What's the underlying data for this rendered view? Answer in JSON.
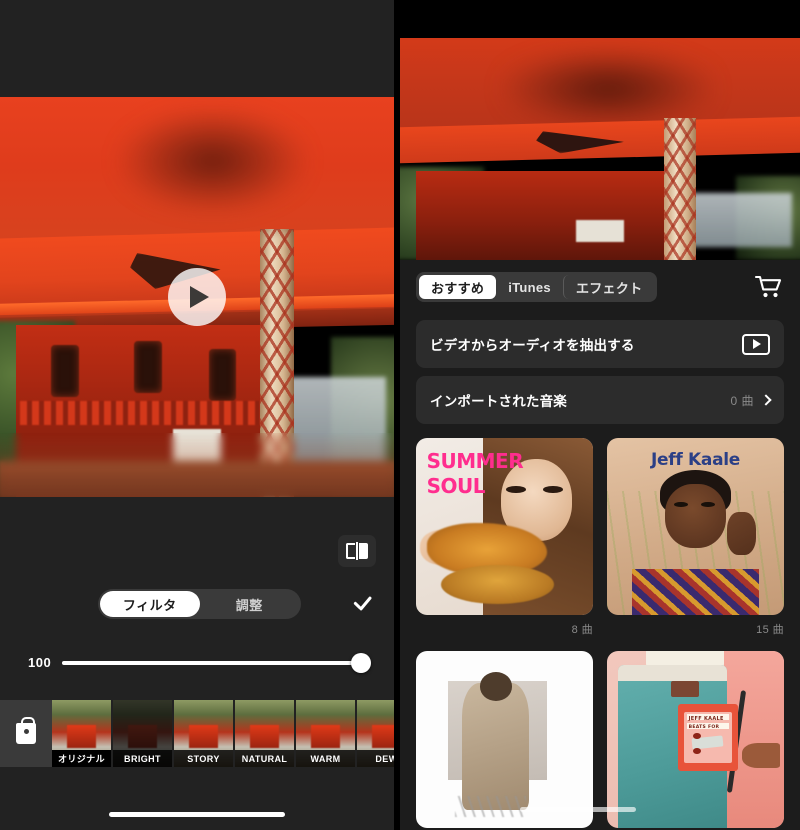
{
  "left_panel": {
    "name": "video-filter-editor",
    "video": {
      "alt": "japanese-shrine-torii-video-preview",
      "play_icon": "play-icon"
    },
    "compare_button": {
      "icon": "split-compare-icon"
    },
    "segmented_control": {
      "options": [
        "フィルタ",
        "調整"
      ],
      "selected_index": 0
    },
    "confirm_icon": "checkmark-icon",
    "slider": {
      "value": "100",
      "percent": 100,
      "min": 0,
      "max": 100
    },
    "shop_icon": "shopping-bag-icon",
    "filters": [
      {
        "label": "オリジナル",
        "selected": true,
        "style": "normal"
      },
      {
        "label": "BRIGHT",
        "selected": false,
        "style": "dark"
      },
      {
        "label": "STORY",
        "selected": false,
        "style": "normal"
      },
      {
        "label": "NATURAL",
        "selected": false,
        "style": "normal"
      },
      {
        "label": "WARM",
        "selected": false,
        "style": "normal"
      },
      {
        "label": "DEW",
        "selected": false,
        "style": "normal"
      }
    ],
    "home_indicator": true
  },
  "right_panel": {
    "name": "music-picker",
    "video": {
      "alt": "japanese-shrine-torii-video-preview"
    },
    "tabs": [
      {
        "label": "おすすめ",
        "selected": true
      },
      {
        "label": "iTunes",
        "selected": false
      },
      {
        "label": "エフェクト",
        "selected": false
      }
    ],
    "cart_icon": "shopping-cart-icon",
    "rows": [
      {
        "label": "ビデオからオーディオを抽出する",
        "accessory": "video-play-button",
        "count": ""
      },
      {
        "label": "インポートされた音楽",
        "accessory": "chevron-right-icon",
        "count": "0 曲"
      }
    ],
    "albums": [
      {
        "title": "SUMMER SOUL",
        "title_line1": "SUMMER",
        "title_line2": "SOUL",
        "count": "8 曲",
        "cover": "summer-soul-cover"
      },
      {
        "title": "Jeff Kaale",
        "count": "15 曲",
        "cover": "jeff-kaale-portrait-cover"
      },
      {
        "title": "",
        "count": "",
        "cover": "white-portrait-cover"
      },
      {
        "title": "",
        "count": "",
        "cover": "cassette-jeans-cover",
        "cassette_label_1": "JEFF KAALE",
        "cassette_label_2": "BEATS FOR"
      }
    ]
  },
  "colors": {
    "panel_bg": "#222222",
    "right_bg": "#1c1c1c",
    "row_bg": "#2c2c2c",
    "segment_bg": "#3a3a3a",
    "accent_white": "#ffffff",
    "muted_text": "#8a8a8a",
    "summer_soul_pink": "#ff2d8e",
    "jeff_blue": "#2b3f86"
  }
}
